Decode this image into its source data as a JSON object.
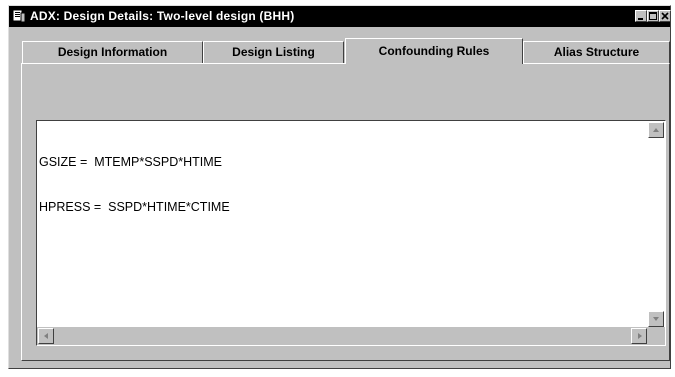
{
  "window": {
    "title": "ADX: Design Details: Two-level design (BHH)",
    "icon": "dialog-window-icon",
    "buttons": {
      "minimize": "minimize-icon",
      "maximize": "maximize-icon",
      "close": "close-icon"
    }
  },
  "tabs": [
    {
      "label": "Design Information",
      "active": false
    },
    {
      "label": "Design Listing",
      "active": false
    },
    {
      "label": "Confounding Rules",
      "active": true
    },
    {
      "label": "Alias Structure",
      "active": false
    }
  ],
  "confounding_rules": {
    "lines": [
      "GSIZE =  MTEMP*SSPD*HTIME",
      "HPRESS =  SSPD*HTIME*CTIME"
    ]
  },
  "colors": {
    "face": "#c0c0c0",
    "titlebar": "#000000",
    "text_bg": "#ffffff"
  }
}
